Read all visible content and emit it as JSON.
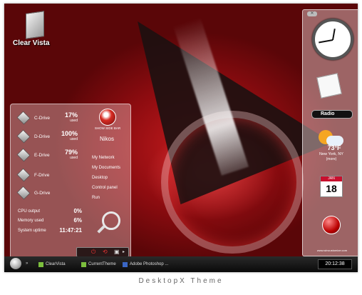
{
  "desktop": {
    "icon_label": "Clear Vista"
  },
  "panel": {
    "drives": [
      {
        "name": "C-Drive",
        "pct": "17%",
        "used": "used"
      },
      {
        "name": "D-Drive",
        "pct": "100%",
        "used": "used"
      },
      {
        "name": "E-Drive",
        "pct": "79%",
        "used": "used"
      },
      {
        "name": "F-Drive",
        "pct": "",
        "used": ""
      },
      {
        "name": "G-Drive",
        "pct": "",
        "used": ""
      }
    ],
    "cpu": {
      "label": "CPU output",
      "value": "0%"
    },
    "memory": {
      "label": "Memory used",
      "value": "6%"
    },
    "uptime": {
      "label": "System uptime",
      "value": "11:47:21"
    },
    "show_desktop": "SHOW SIDE BAR",
    "user": "Nikos",
    "links": [
      "My Network",
      "My Documents",
      "Desktop",
      "Control panel",
      "Run"
    ]
  },
  "sidebar": {
    "radio_label": "Radio",
    "weather": {
      "temp": "73°F",
      "city": "New York, NY",
      "more": "(more)"
    },
    "calendar": {
      "month": "JAN",
      "day": "18"
    },
    "site": "www.wincustomize.com"
  },
  "taskbar": {
    "tasks": [
      "ClearVista",
      "CurrentTheme",
      "Adobe Photoshop ..."
    ],
    "clock": "20:12:38"
  },
  "caption": "DesktopX Theme"
}
